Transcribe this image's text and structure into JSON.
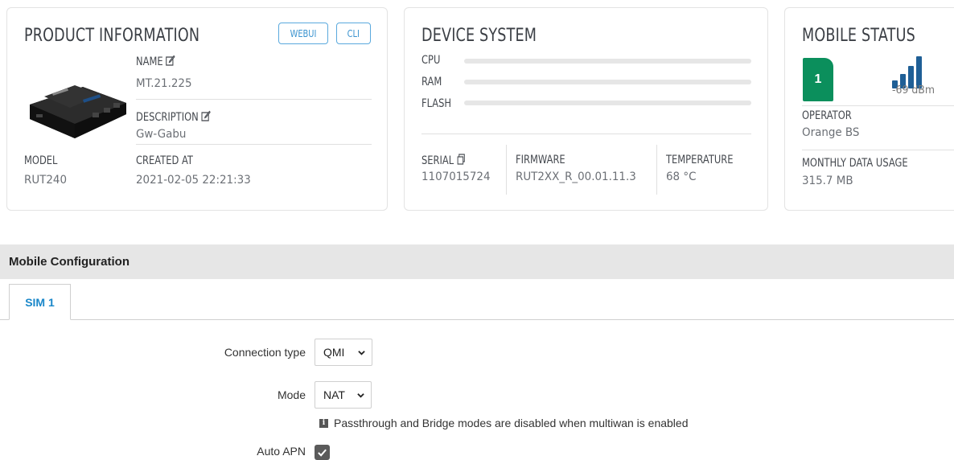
{
  "product": {
    "title": "PRODUCT INFORMATION",
    "webui_label": "WEBUI",
    "cli_label": "CLI",
    "name_label": "NAME",
    "name_value": "MT.21.225",
    "description_label": "DESCRIPTION",
    "description_value": "Gw-Gabu",
    "model_label": "MODEL",
    "model_value": "RUT240",
    "created_label": "CREATED AT",
    "created_value": "2021-02-05 22:21:33"
  },
  "device": {
    "title": "DEVICE SYSTEM",
    "cpu_label": "CPU",
    "ram_label": "RAM",
    "flash_label": "FLASH",
    "cpu_usage": 0,
    "ram_usage": 0,
    "flash_usage": 0,
    "serial_label": "SERIAL",
    "serial_value": "1107015724",
    "firmware_label": "FIRMWARE",
    "firmware_value": "RUT2XX_R_00.01.11.3",
    "temperature_label": "TEMPERATURE",
    "temperature_value": "68 °C"
  },
  "mobile": {
    "title": "MOBILE STATUS",
    "sim_number": "1",
    "signal_value": "-69 dBm",
    "operator_label": "OPERATOR",
    "operator_value": "Orange BS",
    "data_usage_label": "MONTHLY DATA USAGE",
    "data_usage_value": "315.7 MB"
  },
  "config": {
    "section_title": "Mobile Configuration",
    "tab_label": "SIM 1",
    "connection_type_label": "Connection type",
    "connection_type_value": "QMI",
    "mode_label": "Mode",
    "mode_value": "NAT",
    "mode_hint": "Passthrough and Bridge modes are disabled when multiwan is enabled",
    "auto_apn_label": "Auto APN",
    "auto_apn_checked": true
  },
  "colors": {
    "accent": "#3a93cf",
    "sim_green": "#0b8f5c",
    "signal_blue": "#1f5f96"
  }
}
